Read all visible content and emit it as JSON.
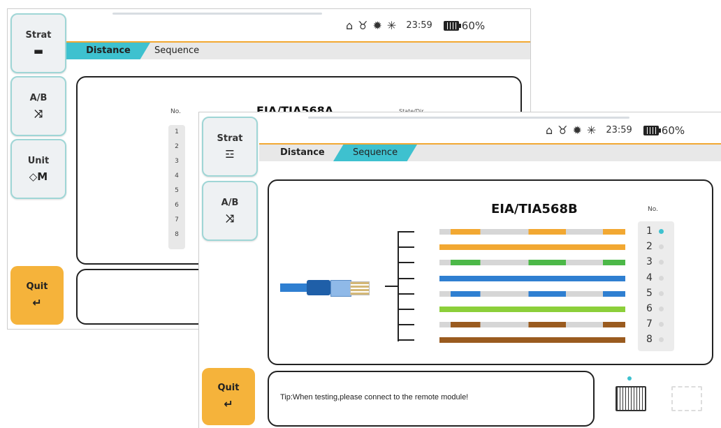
{
  "back": {
    "status": {
      "time": "23:59",
      "battery": "60%"
    },
    "side_buttons": [
      {
        "label": "Strat",
        "icon": "▬"
      },
      {
        "label": "A/B",
        "icon": "⤨"
      },
      {
        "label": "Unit",
        "icon": "◇M"
      }
    ],
    "quit": {
      "label": "Quit",
      "icon": "↵"
    },
    "tabs": [
      "Distance",
      "Sequence"
    ],
    "panel": {
      "no_label": "No.",
      "title": "EIA/TIA568A",
      "state_label": "State/Dir",
      "numbers": [
        "1",
        "2",
        "3",
        "4",
        "5",
        "6",
        "7",
        "8"
      ]
    }
  },
  "front": {
    "status": {
      "time": "23:59",
      "battery": "60%"
    },
    "side_buttons": [
      {
        "label": "Strat",
        "icon": "☲"
      },
      {
        "label": "A/B",
        "icon": "⤨"
      }
    ],
    "quit": {
      "label": "Quit",
      "icon": "↵"
    },
    "tabs": [
      "Distance",
      "Sequence"
    ],
    "panel": {
      "title": "EIA/TIA568B",
      "no_label": "No.",
      "numbers": [
        "1",
        "2",
        "3",
        "4",
        "5",
        "6",
        "7",
        "8"
      ]
    },
    "tip": "Tip:When testing,please connect to the remote module!"
  },
  "icons": [
    "usb-icon",
    "plug-icon",
    "gear-icon",
    "light-icon",
    "battery-icon"
  ],
  "colors": {
    "accent_cyan": "#3ec1cf",
    "accent_orange": "#f2a832",
    "quit_yellow": "#f5b33b",
    "wire_orange": "#f2a832",
    "wire_green": "#4cb848",
    "wire_blue": "#2f7fd1",
    "wire_lightgreen": "#8ccf3a",
    "wire_brown": "#9a5b1f"
  }
}
